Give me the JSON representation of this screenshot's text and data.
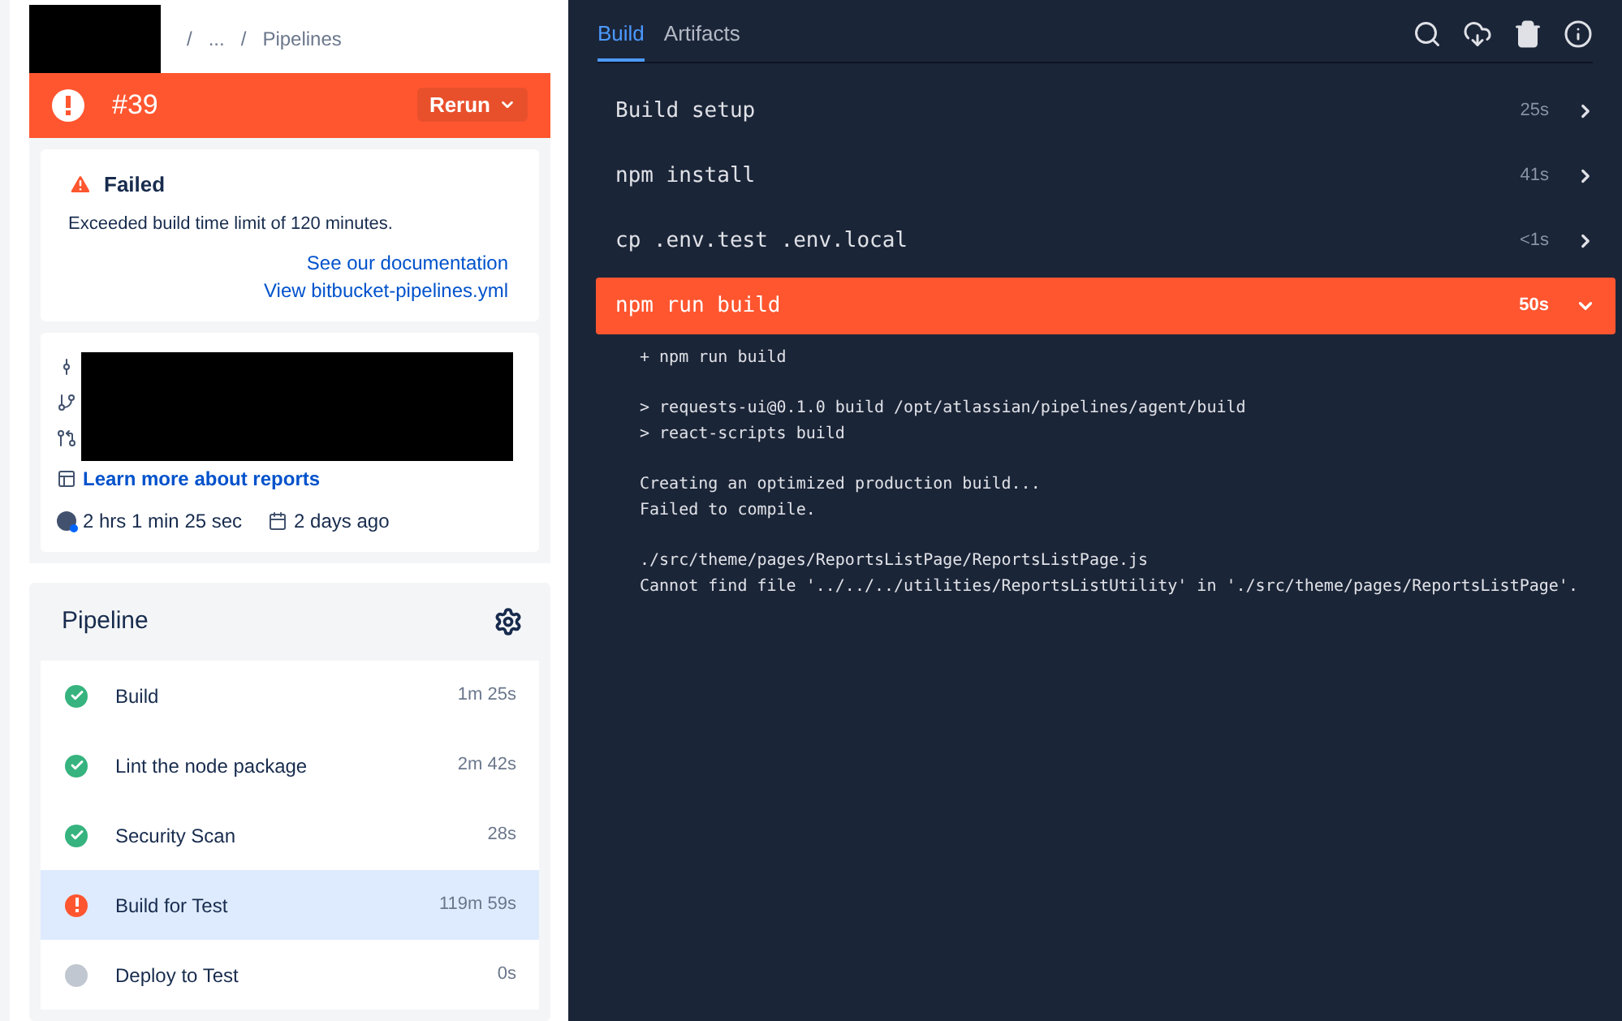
{
  "breadcrumb": [
    "/",
    "...",
    "/",
    "Pipelines"
  ],
  "run": {
    "number": "#39",
    "kind": "failed",
    "rerun_label": "Rerun"
  },
  "failure": {
    "title": "Failed",
    "message": "Exceeded build time limit of 120 minutes.",
    "links": [
      "See our documentation",
      "View bitbucket-pipelines.yml"
    ]
  },
  "details": {
    "report_link": "Learn more about reports",
    "duration": "2 hrs 1 min 25 sec",
    "date": "2 days ago"
  },
  "pipeline": {
    "title": "Pipeline",
    "steps": [
      {
        "name": "Build",
        "duration": "1m 25s",
        "kind": "success",
        "selected": false
      },
      {
        "name": "Lint the node package",
        "duration": "2m 42s",
        "kind": "success",
        "selected": false
      },
      {
        "name": "Security Scan",
        "duration": "28s",
        "kind": "success",
        "selected": false
      },
      {
        "name": "Build for Test",
        "duration": "119m 59s",
        "kind": "failed",
        "selected": true
      },
      {
        "name": "Deploy to Test",
        "duration": "0s",
        "kind": "pending",
        "selected": false
      }
    ]
  },
  "tabs": [
    {
      "label": "Build",
      "selected": true
    },
    {
      "label": "Artifacts",
      "selected": false
    }
  ],
  "commands": [
    {
      "name": "Build setup",
      "duration": "25s",
      "kind": "success",
      "expanded": false
    },
    {
      "name": "npm install",
      "duration": "41s",
      "kind": "success",
      "expanded": false
    },
    {
      "name": "cp .env.test .env.local",
      "duration": "<1s",
      "kind": "success",
      "expanded": false
    },
    {
      "name": "npm run build",
      "duration": "50s",
      "kind": "failed",
      "expanded": true
    }
  ],
  "log": [
    {
      "lines": [
        "+ npm run build"
      ]
    },
    {
      "lines": [
        "> requests-ui@0.1.0 build /opt/atlassian/pipelines/agent/build",
        "> react-scripts build"
      ]
    },
    {
      "lines": [
        "Creating an optimized production build...",
        "Failed to compile."
      ]
    },
    {
      "lines": [
        "./src/theme/pages/ReportsListPage/ReportsListPage.js",
        "Cannot find file '../../../utilities/ReportsListUtility' in './src/theme/pages/ReportsListPage'."
      ]
    }
  ]
}
